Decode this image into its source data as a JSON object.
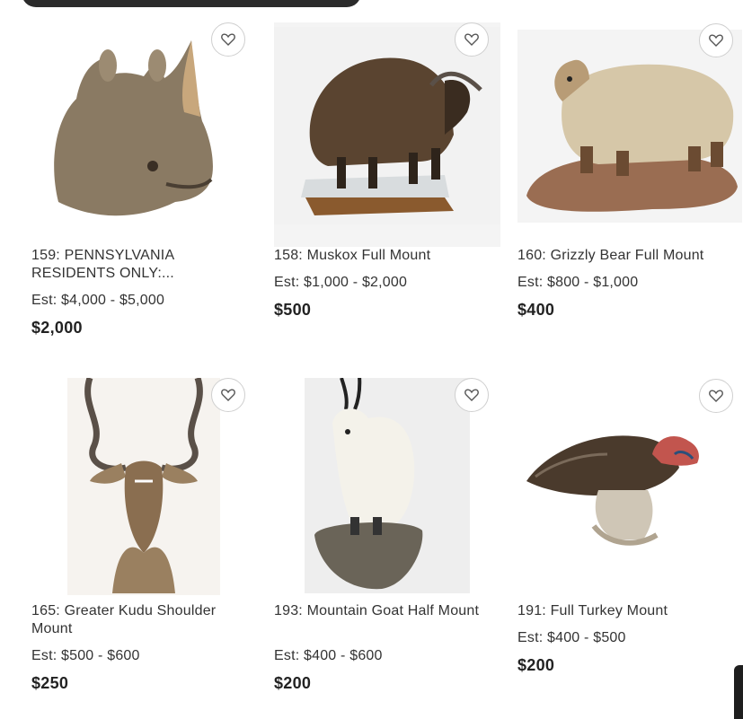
{
  "lots": [
    {
      "title": "159: PENNSYLVANIA RESIDENTS ONLY:...",
      "estimate": "Est: $4,000 - $5,000",
      "price": "$2,000",
      "image": "rhino-head-mount"
    },
    {
      "title": "158: Muskox Full Mount",
      "estimate": "Est: $1,000 - $2,000",
      "price": "$500",
      "image": "muskox-full-mount"
    },
    {
      "title": "160: Grizzly Bear Full Mount",
      "estimate": "Est: $800 - $1,000",
      "price": "$400",
      "image": "grizzly-bear-full-mount"
    },
    {
      "title": "165: Greater Kudu Shoulder Mount",
      "estimate": "Est: $500 - $600",
      "price": "$250",
      "image": "kudu-shoulder-mount"
    },
    {
      "title": "193: Mountain Goat Half Mount",
      "estimate": "Est: $400 - $600",
      "price": "$200",
      "image": "mountain-goat-half-mount"
    },
    {
      "title": "191: Full Turkey Mount",
      "estimate": "Est: $400 - $500",
      "price": "$200",
      "image": "turkey-full-mount"
    }
  ],
  "icons": {
    "favorite": "heart-outline-icon"
  },
  "colors": {
    "text": "#333333",
    "price": "#222222",
    "favorite_border": "#cfcfcf"
  }
}
